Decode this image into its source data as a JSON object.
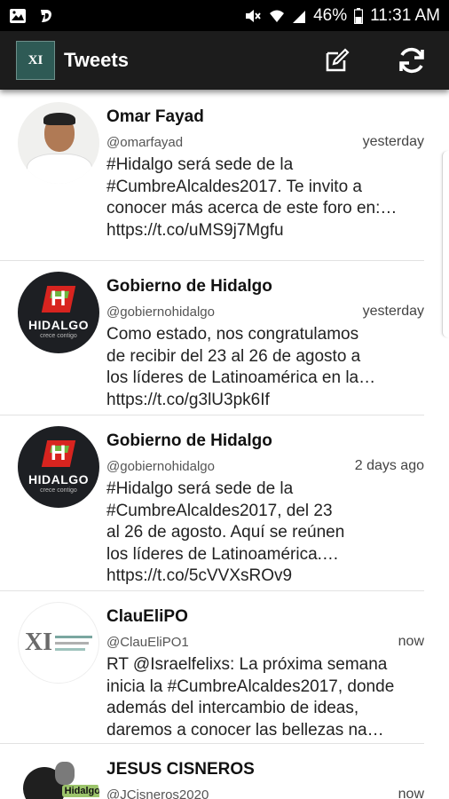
{
  "status_bar": {
    "battery_percent": "46%",
    "time": "11:31 AM",
    "icons": [
      "image-icon",
      "d-app-icon",
      "mute-icon",
      "wifi-icon",
      "signal-icon",
      "battery-icon"
    ]
  },
  "app_bar": {
    "logo_text": "XI",
    "title": "Tweets",
    "actions": [
      "compose-icon",
      "refresh-icon"
    ]
  },
  "tweets": [
    {
      "name": "Omar Fayad",
      "handle": "@omarfayad",
      "time": "yesterday",
      "lines": [
        "#Hidalgo será sede de la",
        "#CumbreAlcaldes2017. Te invito a",
        "conocer más acerca de este foro en:…",
        "https://t.co/uMS9j7Mgfu"
      ]
    },
    {
      "name": "Gobierno de Hidalgo",
      "handle": "@gobiernohidalgo",
      "time": "yesterday",
      "avatar": {
        "letter": "H",
        "word": "HIDALGO",
        "sub": "crece contigo"
      },
      "lines": [
        "Como estado, nos congratulamos",
        "de recibir del 23 al 26 de agosto a",
        "los líderes de Latinoamérica en la…",
        "https://t.co/g3lU3pk6If"
      ]
    },
    {
      "name": "Gobierno de Hidalgo",
      "handle": "@gobiernohidalgo",
      "time": "2 days ago",
      "avatar": {
        "letter": "H",
        "word": "HIDALGO",
        "sub": "crece contigo"
      },
      "lines": [
        "#Hidalgo será sede de la",
        "#CumbreAlcaldes2017, del 23",
        "al 26 de agosto. Aquí se reúnen",
        "los líderes de Latinoamérica.…",
        "https://t.co/5cVVXsROv9"
      ]
    },
    {
      "name": "ClauEliPO",
      "handle": "@ClauEliPO1",
      "time": "now",
      "avatar": {
        "letter": "XI"
      },
      "lines": [
        "RT @Israelfelixs: La próxima semana",
        "inicia la #CumbreAlcaldes2017, donde",
        "además del intercambio de ideas,",
        "daremos a conocer las bellezas na…"
      ]
    },
    {
      "name": "JESUS CISNEROS",
      "handle": "@JCisneros2020",
      "time": "now",
      "avatar": {
        "label": "Hidalgo"
      },
      "lines": []
    }
  ],
  "colors": {
    "status_bar": "#000000",
    "app_bar": "#1c1c1c",
    "hidalgo_red": "#d8241f",
    "hidalgo_green": "#6fb43f",
    "divider": "#e2e2e2"
  }
}
